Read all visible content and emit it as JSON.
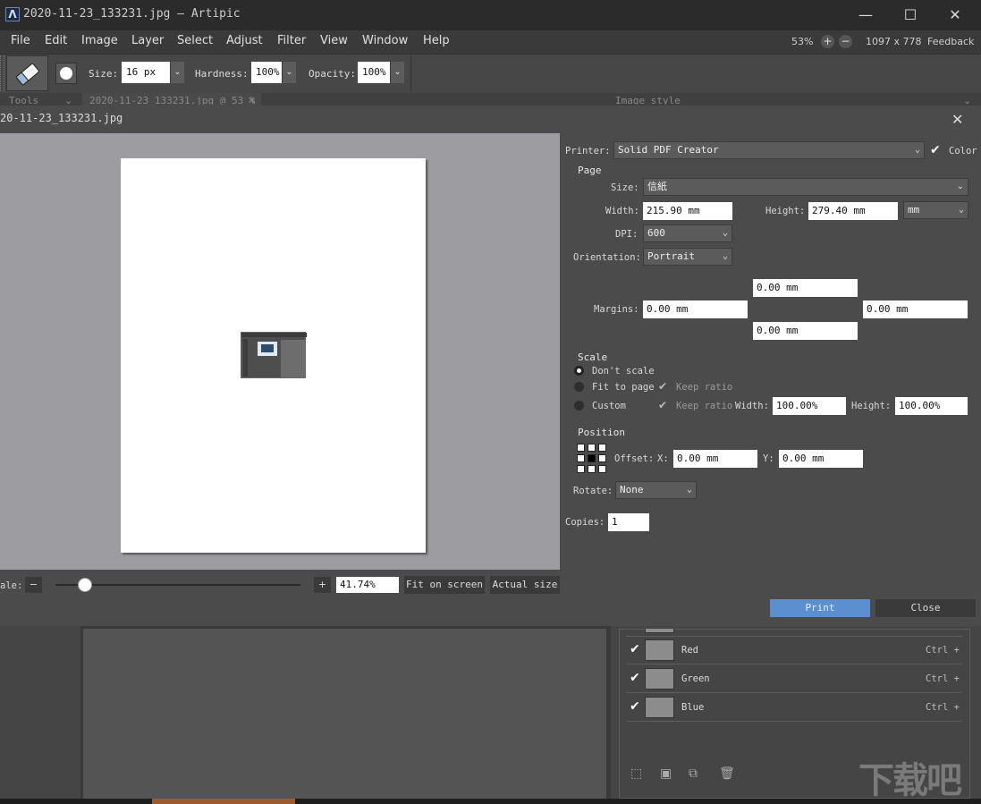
{
  "window": {
    "logo_letter": "Λ",
    "title": "2020-11-23_133231.jpg  —  Artipic",
    "minimize": "—",
    "maximize": "☐",
    "close": "✕"
  },
  "menu": {
    "items": [
      "File",
      "Edit",
      "Image",
      "Layer",
      "Select",
      "Adjust",
      "Filter",
      "View",
      "Window",
      "Help"
    ],
    "zoom": "53%",
    "zoom_in": "+",
    "zoom_out": "−",
    "dimensions": "1097 x 778",
    "feedback": "Feedback"
  },
  "tool_options": {
    "size_label": "Size:",
    "size_value": "16 px",
    "hardness_label": "Hardness:",
    "hardness_value": "100%",
    "opacity_label": "Opacity:",
    "opacity_value": "100%"
  },
  "background_strip": {
    "tools_label": "Tools",
    "doc_tab": "2020-11-23_133231.jpg @ 53 %",
    "image_style": "Image style"
  },
  "dialog": {
    "title": "20-11-23_133231.jpg",
    "close": "✕",
    "printer_label": "Printer:",
    "printer_value": "Solid PDF Creator",
    "color_label": "Color",
    "page_title": "Page",
    "size_label": "Size:",
    "size_value": "信紙",
    "width_label": "Width:",
    "width_value": "215.90 mm",
    "height_label": "Height:",
    "height_value": "279.40 mm",
    "unit_value": "mm",
    "dpi_label": "DPI:",
    "dpi_value": "600",
    "orientation_label": "Orientation:",
    "orientation_value": "Portrait",
    "margins_label": "Margins:",
    "margin_top": "0.00 mm",
    "margin_left": "0.00 mm",
    "margin_right": "0.00 mm",
    "margin_bottom": "0.00 mm",
    "scale_title": "Scale",
    "dont_scale": "Don't scale",
    "fit_to_page": "Fit to page",
    "keep_ratio": "Keep ratio",
    "custom": "Custom",
    "scale_width_label": "Width:",
    "scale_width_value": "100.00%",
    "scale_height_label": "Height:",
    "scale_height_value": "100.00%",
    "position_title": "Position",
    "offset_label": "Offset:",
    "x_label": "X:",
    "x_value": "0.00 mm",
    "y_label": "Y:",
    "y_value": "0.00 mm",
    "rotate_label": "Rotate:",
    "rotate_value": "None",
    "copies_label": "Copies:",
    "copies_value": "1",
    "scale_bar_label": "ale:",
    "scale_minus": "−",
    "scale_plus": "+",
    "scale_percent": "41.74%",
    "scale_fraction": 0.12,
    "fit_on_screen": "Fit on screen",
    "actual_size": "Actual size",
    "print": "Print",
    "close_button": "Close"
  },
  "layers": [
    {
      "name": "Red",
      "shortcut": "Ctrl +"
    },
    {
      "name": "Green",
      "shortcut": "Ctrl +"
    },
    {
      "name": "Blue",
      "shortcut": "Ctrl +"
    }
  ],
  "watermark": "下载吧"
}
